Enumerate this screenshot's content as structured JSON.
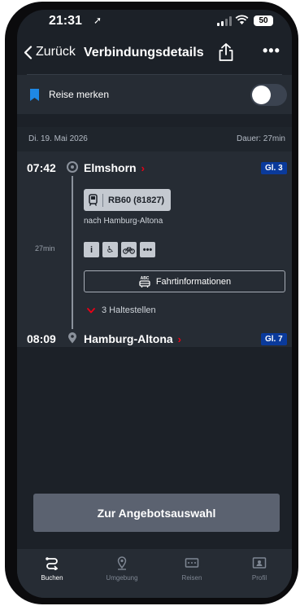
{
  "status": {
    "time": "21:31",
    "battery": "50"
  },
  "nav": {
    "back_label": "Zurück",
    "title": "Verbindungsdetails"
  },
  "save_trip": {
    "label": "Reise merken",
    "toggle_on": false
  },
  "trip": {
    "date": "Di. 19. Mai 2026",
    "duration": "Dauer: 27min",
    "departure": {
      "time": "07:42",
      "station": "Elmshorn",
      "track": "Gl. 3"
    },
    "arrival": {
      "time": "08:09",
      "station": "Hamburg-Altona",
      "track": "Gl. 7"
    },
    "train": "RB60 (81827)",
    "direction": "nach Hamburg-Altona",
    "segment_duration": "27min",
    "amenities": [
      "info-icon",
      "wheelchair-icon",
      "bicycle-icon",
      "more-icon"
    ],
    "info_button": "Fahrtinformationen",
    "stops": "3 Haltestellen"
  },
  "cta": {
    "label": "Zur Angebotsauswahl"
  },
  "tabbar": {
    "items": [
      {
        "label": "Buchen",
        "icon": "route-icon",
        "active": true
      },
      {
        "label": "Umgebung",
        "icon": "location-pin-icon",
        "active": false
      },
      {
        "label": "Reisen",
        "icon": "ticket-icon",
        "active": false
      },
      {
        "label": "Profil",
        "icon": "profile-icon",
        "active": false
      }
    ]
  },
  "colors": {
    "background": "#1c2128",
    "card": "#262c34",
    "accent_red": "#ec0016",
    "track_blue": "#0a3a9b",
    "cta": "#5b6270"
  }
}
